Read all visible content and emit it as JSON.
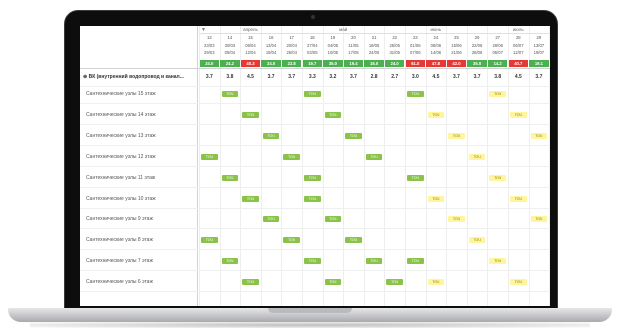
{
  "header": {
    "months": [
      {
        "label": "апрель",
        "col_start": 0,
        "col_span": 5
      },
      {
        "label": "май",
        "col_start": 5,
        "col_span": 4
      },
      {
        "label": "июнь",
        "col_start": 9,
        "col_span": 5
      },
      {
        "label": "июль",
        "col_start": 14,
        "col_span": 3
      }
    ],
    "weeks": [
      "13",
      "14",
      "15",
      "16",
      "17",
      "18",
      "19",
      "20",
      "21",
      "22",
      "23",
      "24",
      "25",
      "26",
      "27",
      "28",
      "29"
    ],
    "date_top": [
      "23/03",
      "30/03",
      "06/04",
      "13/04",
      "20/04",
      "27/04",
      "04/05",
      "11/05",
      "18/05",
      "25/05",
      "01/06",
      "08/06",
      "15/06",
      "22/06",
      "29/06",
      "06/07",
      "13/07"
    ],
    "date_bottom": [
      "29/03",
      "05/04",
      "12/04",
      "19/04",
      "26/04",
      "03/05",
      "10/05",
      "17/05",
      "24/05",
      "31/05",
      "07/06",
      "14/06",
      "21/06",
      "28/06",
      "05/07",
      "12/07",
      "19/07"
    ],
    "values": [
      {
        "v": "24.0",
        "c": "#4caf50"
      },
      {
        "v": "24.2",
        "c": "#4caf50"
      },
      {
        "v": "40.3",
        "c": "#e53935"
      },
      {
        "v": "24.0",
        "c": "#4caf50"
      },
      {
        "v": "22.8",
        "c": "#4caf50"
      },
      {
        "v": "19.7",
        "c": "#4caf50"
      },
      {
        "v": "35.0",
        "c": "#4caf50"
      },
      {
        "v": "19.4",
        "c": "#4caf50"
      },
      {
        "v": "16.0",
        "c": "#4caf50"
      },
      {
        "v": "24.0",
        "c": "#4caf50"
      },
      {
        "v": "61.0",
        "c": "#e53935"
      },
      {
        "v": "47.8",
        "c": "#e53935"
      },
      {
        "v": "42.0",
        "c": "#e53935"
      },
      {
        "v": "35.0",
        "c": "#4caf50"
      },
      {
        "v": "14.2",
        "c": "#4caf50"
      },
      {
        "v": "40.7",
        "c": "#e53935"
      },
      {
        "v": "19.1",
        "c": "#4caf50"
      }
    ]
  },
  "group": {
    "label": "ВК (внутренний водопровод и канал...",
    "values": [
      "3.7",
      "3.8",
      "4.5",
      "3.7",
      "3.7",
      "3.3",
      "3.2",
      "3.7",
      "2.8",
      "2.7",
      "3.0",
      "4.5",
      "3.7",
      "3.7",
      "3.8",
      "4.5",
      "3.7"
    ]
  },
  "rows": [
    {
      "label": "Сантехнические узлы 15 этаж",
      "bars": [
        {
          "col": 1,
          "t": "ТОЧ",
          "k": "green"
        },
        {
          "col": 5,
          "t": "ТОЧ",
          "k": "green"
        },
        {
          "col": 10,
          "t": "ТОЧ",
          "k": "green"
        },
        {
          "col": 14,
          "t": "ТОЧ",
          "k": "yellow"
        }
      ]
    },
    {
      "label": "Сантехнические узлы 14 этаж",
      "bars": [
        {
          "col": 2,
          "t": "ТОЧ",
          "k": "green"
        },
        {
          "col": 6,
          "t": "ТОЧ",
          "k": "green"
        },
        {
          "col": 11,
          "t": "ТОЧ",
          "k": "yellow"
        },
        {
          "col": 15,
          "t": "ТОЧ",
          "k": "yellow"
        }
      ]
    },
    {
      "label": "Сантехнические узлы 13 этаж",
      "bars": [
        {
          "col": 3,
          "t": "ТОЧ",
          "k": "green"
        },
        {
          "col": 7,
          "t": "ТОЧ",
          "k": "green"
        },
        {
          "col": 12,
          "t": "ТОЧ",
          "k": "yellow"
        },
        {
          "col": 16,
          "t": "ТОЧ",
          "k": "yellow"
        }
      ]
    },
    {
      "label": "Сантехнические узлы 12 этаж",
      "bars": [
        {
          "col": 0,
          "t": "ТОЧ",
          "k": "green"
        },
        {
          "col": 4,
          "t": "ТОЧ",
          "k": "green"
        },
        {
          "col": 8,
          "t": "ТОЧ",
          "k": "green"
        },
        {
          "col": 13,
          "t": "ТОЧ",
          "k": "yellow"
        }
      ]
    },
    {
      "label": "Сантехнические узлы 11 этаж",
      "bars": [
        {
          "col": 1,
          "t": "ТОЧ",
          "k": "green"
        },
        {
          "col": 5,
          "t": "ТОЧ",
          "k": "green"
        },
        {
          "col": 10,
          "t": "ТОЧ",
          "k": "green"
        },
        {
          "col": 14,
          "t": "ТОЧ",
          "k": "yellow"
        }
      ]
    },
    {
      "label": "Сантехнические узлы 10 этаж",
      "bars": [
        {
          "col": 2,
          "t": "ТОЧ",
          "k": "green"
        },
        {
          "col": 5,
          "t": "ТОЧ",
          "k": "green"
        },
        {
          "col": 11,
          "t": "ТОЧ",
          "k": "yellow"
        },
        {
          "col": 15,
          "t": "ТОЧ",
          "k": "yellow"
        }
      ]
    },
    {
      "label": "Сантехнические узлы 9 этаж",
      "bars": [
        {
          "col": 3,
          "t": "ТОЧ",
          "k": "green"
        },
        {
          "col": 6,
          "t": "ТОЧ",
          "k": "green"
        },
        {
          "col": 12,
          "t": "ТОЧ",
          "k": "yellow"
        },
        {
          "col": 16,
          "t": "ТОЧ",
          "k": "yellow"
        }
      ]
    },
    {
      "label": "Сантехнические узлы 8 этаж",
      "bars": [
        {
          "col": 0,
          "t": "ТОЧ",
          "k": "green"
        },
        {
          "col": 4,
          "t": "ТОЧ",
          "k": "green"
        },
        {
          "col": 7,
          "t": "ТОЧ",
          "k": "green"
        },
        {
          "col": 13,
          "t": "ТОЧ",
          "k": "yellow"
        }
      ]
    },
    {
      "label": "Сантехнические узлы 7 этаж",
      "bars": [
        {
          "col": 1,
          "t": "ТОЧ",
          "k": "green"
        },
        {
          "col": 5,
          "t": "ТОЧ",
          "k": "green"
        },
        {
          "col": 8,
          "t": "ТОЧ",
          "k": "green"
        },
        {
          "col": 10,
          "t": "ТОЧ",
          "k": "green"
        },
        {
          "col": 14,
          "t": "ТОЧ",
          "k": "yellow"
        }
      ]
    },
    {
      "label": "Сантехнические узлы 6 этаж",
      "bars": [
        {
          "col": 2,
          "t": "ТОЧ",
          "k": "green"
        },
        {
          "col": 6,
          "t": "ТОЧ",
          "k": "green"
        },
        {
          "col": 9,
          "t": "ТОЧ",
          "k": "green"
        },
        {
          "col": 11,
          "t": "ТОЧ",
          "k": "yellow"
        },
        {
          "col": 15,
          "t": "ТОЧ",
          "k": "yellow"
        }
      ]
    }
  ]
}
